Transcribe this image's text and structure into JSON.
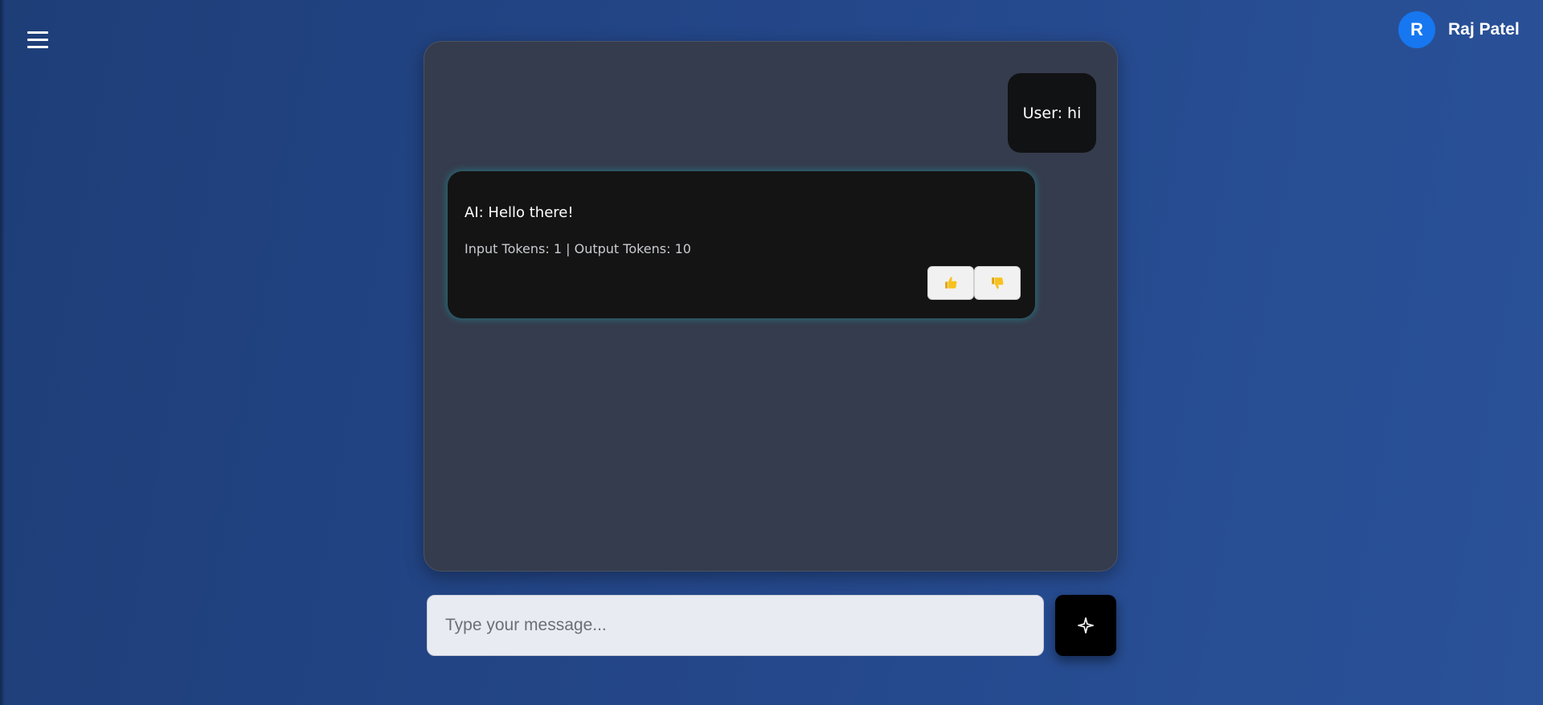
{
  "header": {
    "menu_icon": "hamburger-menu-icon",
    "user": {
      "avatar_initial": "R",
      "name": "Raj Patel",
      "avatar_color": "#1677f0"
    }
  },
  "chat": {
    "messages": [
      {
        "role": "user",
        "text": "User: hi"
      },
      {
        "role": "ai",
        "text": "AI: Hello there!",
        "tokens": "Input Tokens: 1 | Output Tokens: 10",
        "feedback": {
          "like_icon": "thumbs-up-icon",
          "dislike_icon": "thumbs-down-icon"
        }
      }
    ]
  },
  "composer": {
    "placeholder": "Type your message...",
    "value": "",
    "send_icon": "sparkle-icon"
  },
  "colors": {
    "background": "#24478a",
    "panel": "#353c4d",
    "bubble": "#141414",
    "glow": "#208c96",
    "accent": "#1677f0"
  }
}
